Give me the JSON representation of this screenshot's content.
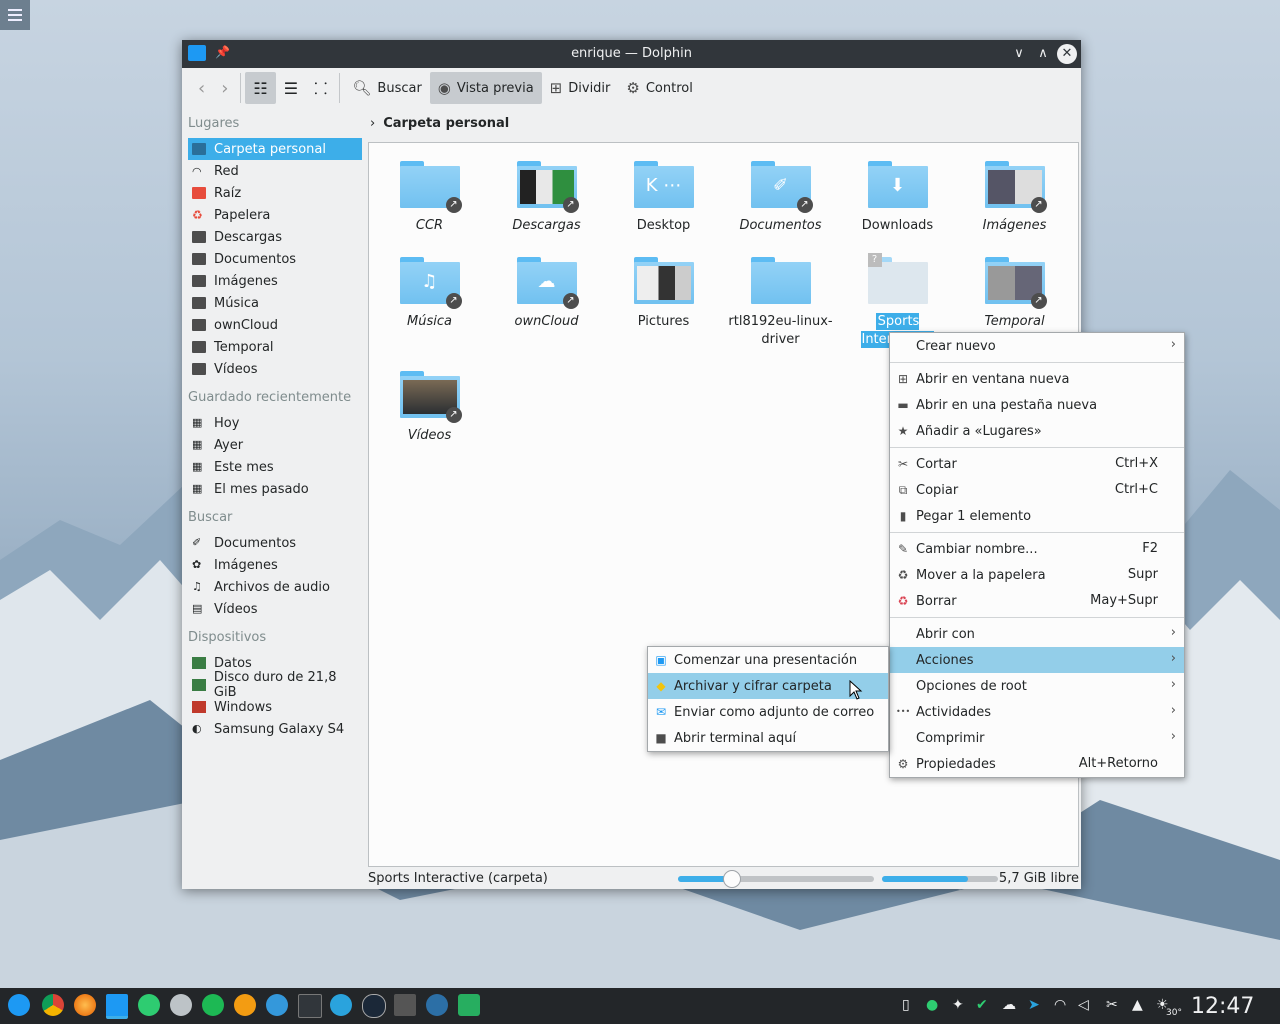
{
  "window": {
    "title": "enrique — Dolphin",
    "pin_icon": "pin-icon",
    "buttons": [
      "minimize-icon",
      "maximize-icon",
      "close-icon"
    ]
  },
  "toolbar": {
    "back_icon": "arrow-left-icon",
    "forward_icon": "arrow-right-icon",
    "view_icons": "icons-view-icon",
    "view_compact": "compact-view-icon",
    "view_tree": "details-view-icon",
    "search_label": "Buscar",
    "preview_label": "Vista previa",
    "split_label": "Dividir",
    "control_label": "Control"
  },
  "sidebar": {
    "places_header": "Lugares",
    "places": [
      {
        "label": "Carpeta personal",
        "icon": "home-icon",
        "selected": true
      },
      {
        "label": "Red",
        "icon": "network-icon"
      },
      {
        "label": "Raíz",
        "icon": "root-folder-icon"
      },
      {
        "label": "Papelera",
        "icon": "trash-icon"
      },
      {
        "label": "Descargas",
        "icon": "folder-icon"
      },
      {
        "label": "Documentos",
        "icon": "folder-icon"
      },
      {
        "label": "Imágenes",
        "icon": "folder-icon"
      },
      {
        "label": "Música",
        "icon": "folder-icon"
      },
      {
        "label": "ownCloud",
        "icon": "folder-icon"
      },
      {
        "label": "Temporal",
        "icon": "folder-icon"
      },
      {
        "label": "Vídeos",
        "icon": "folder-icon"
      }
    ],
    "recent_header": "Guardado recientemente",
    "recent": [
      {
        "label": "Hoy",
        "icon": "calendar-icon"
      },
      {
        "label": "Ayer",
        "icon": "calendar-icon"
      },
      {
        "label": "Este mes",
        "icon": "calendar-icon"
      },
      {
        "label": "El mes pasado",
        "icon": "calendar-icon"
      }
    ],
    "search_header": "Buscar",
    "search": [
      {
        "label": "Documentos",
        "icon": "paperclip-icon"
      },
      {
        "label": "Imágenes",
        "icon": "flower-icon"
      },
      {
        "label": "Archivos de audio",
        "icon": "music-note-icon"
      },
      {
        "label": "Vídeos",
        "icon": "film-icon"
      }
    ],
    "devices_header": "Dispositivos",
    "devices": [
      {
        "label": "Datos",
        "icon": "drive-icon"
      },
      {
        "label": "Disco duro de 21,8 GiB",
        "icon": "drive-icon"
      },
      {
        "label": "Windows",
        "icon": "drive-red-icon"
      },
      {
        "label": "Samsung Galaxy S4",
        "icon": "phone-icon"
      }
    ]
  },
  "breadcrumb": {
    "label": "Carpeta personal"
  },
  "files": [
    {
      "name": "CCR",
      "italic": true,
      "link": true
    },
    {
      "name": "Descargas",
      "italic": true,
      "link": true
    },
    {
      "name": "Desktop",
      "italic": false,
      "link": false
    },
    {
      "name": "Documentos",
      "italic": true,
      "link": true
    },
    {
      "name": "Downloads",
      "italic": false,
      "link": false
    },
    {
      "name": "Imágenes",
      "italic": true,
      "link": true
    },
    {
      "name": "Música",
      "italic": true,
      "link": true
    },
    {
      "name": "ownCloud",
      "italic": true,
      "link": true
    },
    {
      "name": "Pictures",
      "italic": false,
      "link": false
    },
    {
      "name": "rtl8192eu-linux-driver",
      "italic": false,
      "link": false
    },
    {
      "name": "Sports Interactive",
      "italic": false,
      "link": false,
      "selected": true
    },
    {
      "name": "Temporal",
      "italic": true,
      "link": true
    },
    {
      "name": "Vídeos",
      "italic": true,
      "link": true
    }
  ],
  "status": {
    "text": "Sports Interactive (carpeta)",
    "zoom_fraction": 0.27,
    "space_used_fraction": 0.74,
    "free_space": "5,7 GiB libre"
  },
  "context_menu": {
    "items": [
      {
        "label": "Crear nuevo",
        "icon": "",
        "submenu": true
      },
      {
        "sep": true
      },
      {
        "label": "Abrir en ventana nueva",
        "icon": "new-window-icon"
      },
      {
        "label": "Abrir en una pestaña nueva",
        "icon": "new-tab-icon"
      },
      {
        "label": "Añadir a «Lugares»",
        "icon": "star-icon"
      },
      {
        "sep": true
      },
      {
        "label": "Cortar",
        "icon": "scissors-icon",
        "shortcut": "Ctrl+X"
      },
      {
        "label": "Copiar",
        "icon": "copy-icon",
        "shortcut": "Ctrl+C"
      },
      {
        "label": "Pegar 1 elemento",
        "icon": "paste-icon"
      },
      {
        "sep": true
      },
      {
        "label": "Cambiar nombre...",
        "icon": "pencil-icon",
        "shortcut": "F2"
      },
      {
        "label": "Mover a la papelera",
        "icon": "recycle-icon",
        "shortcut": "Supr"
      },
      {
        "label": "Borrar",
        "icon": "delete-icon",
        "shortcut": "May+Supr"
      },
      {
        "sep": true
      },
      {
        "label": "Abrir con",
        "icon": "",
        "submenu": true
      },
      {
        "label": "Acciones",
        "icon": "",
        "submenu": true,
        "highlighted": true
      },
      {
        "label": "Opciones de root",
        "icon": "",
        "submenu": true
      },
      {
        "label": "Actividades",
        "icon": "dots-icon",
        "submenu": true
      },
      {
        "label": "Comprimir",
        "icon": "",
        "submenu": true
      },
      {
        "label": "Propiedades",
        "icon": "gear-icon",
        "shortcut": "Alt+Retorno"
      }
    ]
  },
  "actions_submenu": {
    "items": [
      {
        "label": "Comenzar una presentación",
        "icon": "presentation-icon"
      },
      {
        "label": "Archivar y cifrar carpeta",
        "icon": "shield-icon",
        "highlighted": true
      },
      {
        "label": "Enviar como adjunto de correo",
        "icon": "mail-icon"
      },
      {
        "label": "Abrir terminal aquí",
        "icon": "terminal-icon"
      }
    ]
  },
  "taskbar": {
    "apps": [
      "kde-launcher-icon",
      "chrome-icon",
      "firefox-icon",
      "dolphin-icon",
      "ghost-icon",
      "settings-icon",
      "spotify-icon",
      "music-player-icon",
      "browser-icon",
      "terminal-icon",
      "telegram-icon",
      "steam-icon",
      "user-icon",
      "vpn-icon",
      "screenshot-icon"
    ],
    "tray": [
      "phone-icon",
      "ghost-tray-icon",
      "bluetooth-icon",
      "check-icon",
      "cloud-icon",
      "telegram-tray-icon",
      "wifi-icon",
      "volume-icon",
      "scissors-tray-icon",
      "arrow-up-icon",
      "weather-icon"
    ],
    "temperature": "30°",
    "clock": "12:47"
  }
}
